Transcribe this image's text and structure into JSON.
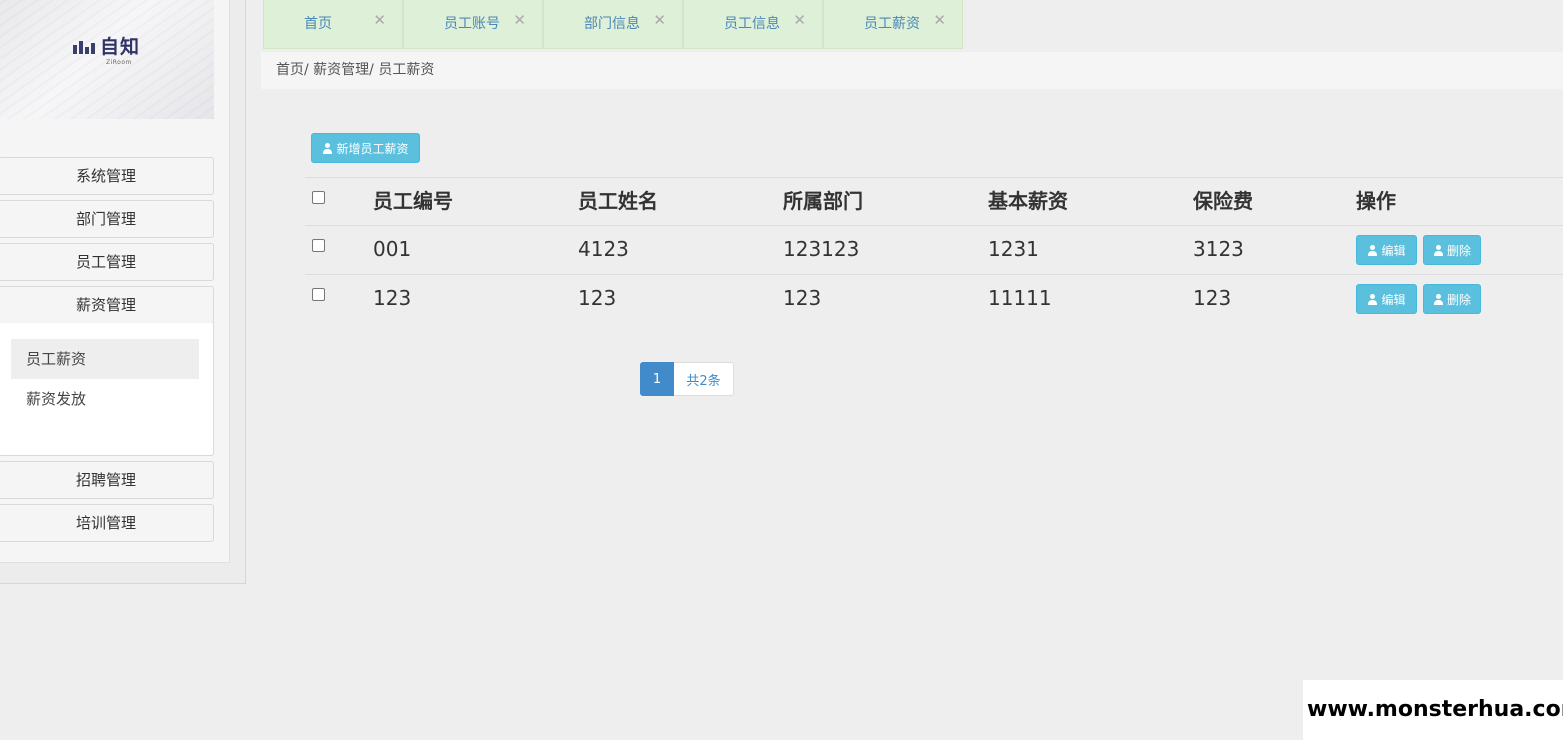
{
  "logo": {
    "text": "自知",
    "subtext": "ZiRoom"
  },
  "sidebar": {
    "items": [
      {
        "label": "系统管理"
      },
      {
        "label": "部门管理"
      },
      {
        "label": "员工管理"
      },
      {
        "label": "薪资管理"
      },
      {
        "label": "招聘管理"
      },
      {
        "label": "培训管理"
      }
    ],
    "submenu": [
      {
        "label": "员工薪资",
        "active": true
      },
      {
        "label": "薪资发放",
        "active": false
      }
    ]
  },
  "tabs": [
    {
      "label": "首页",
      "close": "✕"
    },
    {
      "label": "员工账号",
      "close": "✕"
    },
    {
      "label": "部门信息",
      "close": "✕"
    },
    {
      "label": "员工信息",
      "close": "✕"
    },
    {
      "label": "员工薪资",
      "close": "✕"
    }
  ],
  "breadcrumb": "首页/ 薪资管理/ 员工薪资",
  "toolbar": {
    "add_label": "新增员工薪资"
  },
  "table": {
    "headers": [
      "员工编号",
      "员工姓名",
      "所属部门",
      "基本薪资",
      "保险费",
      "操作"
    ],
    "rows": [
      {
        "id": "001",
        "name": "4123",
        "dept": "123123",
        "salary": "1231",
        "insurance": "3123"
      },
      {
        "id": "123",
        "name": "123",
        "dept": "123",
        "salary": "11111",
        "insurance": "123"
      }
    ],
    "edit_label": "编辑",
    "delete_label": "删除"
  },
  "pagination": {
    "current": "1",
    "total": "共2条"
  },
  "watermark": "www.monsterhua.com",
  "colors": {
    "info_button": "#5bc0de",
    "primary": "#428bca",
    "tab_bg": "#dff0d8",
    "tab_text": "#4a88b7"
  }
}
